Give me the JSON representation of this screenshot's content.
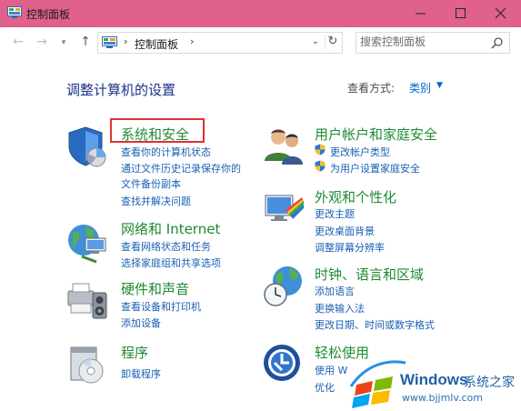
{
  "window": {
    "title": "控制面板"
  },
  "navbar": {
    "breadcrumb": "控制面板",
    "search_placeholder": "搜索控制面板"
  },
  "main": {
    "heading": "调整计算机的设置",
    "view_by_label": "查看方式:",
    "view_by_value": "类别"
  },
  "categories": [
    {
      "title": "系统和安全",
      "icon": "system-security-icon",
      "links": [
        "查看你的计算机状态",
        "通过文件历史记录保存你的",
        "文件备份副本",
        "查找并解决问题"
      ]
    },
    {
      "title": "网络和 Internet",
      "icon": "network-internet-icon",
      "links": [
        "查看网络状态和任务",
        "选择家庭组和共享选项"
      ]
    },
    {
      "title": "硬件和声音",
      "icon": "hardware-sound-icon",
      "links": [
        "查看设备和打印机",
        "添加设备"
      ]
    },
    {
      "title": "程序",
      "icon": "programs-icon",
      "links": [
        "卸载程序"
      ]
    },
    {
      "title": "用户帐户和家庭安全",
      "icon": "user-accounts-icon",
      "links": [
        "更改帐户类型",
        "为用户设置家庭安全"
      ]
    },
    {
      "title": "外观和个性化",
      "icon": "appearance-icon",
      "links": [
        "更改主题",
        "更改桌面背景",
        "调整屏幕分辨率"
      ]
    },
    {
      "title": "时钟、语言和区域",
      "icon": "clock-language-icon",
      "links": [
        "添加语言",
        "更换输入法",
        "更改日期、时间或数字格式"
      ]
    },
    {
      "title": "轻松使用",
      "icon": "ease-of-access-icon",
      "links": [
        "使用 W",
        "优化"
      ]
    }
  ],
  "watermark": {
    "brand": "Windows",
    "suffix": "系统之家",
    "url": "www.bjjmlv.com"
  },
  "colors": {
    "titlebar": "#e0618b",
    "category_title": "#1f8a34",
    "link": "#1a5fb4",
    "heading": "#1e3287",
    "highlight": "#e03131"
  }
}
